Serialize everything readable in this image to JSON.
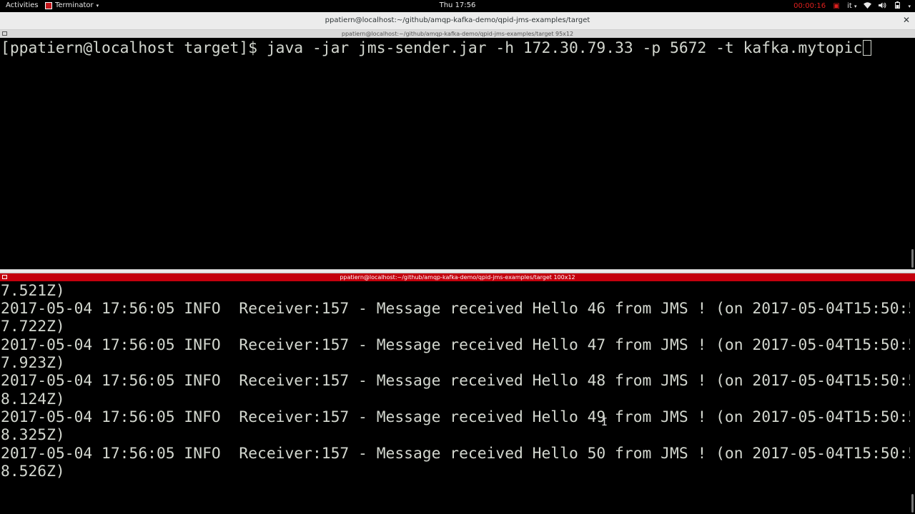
{
  "topbar": {
    "activities_label": "Activities",
    "app_name": "Terminator",
    "clock": "Thu 17:56",
    "recording_time": "00:00:16",
    "language": "it",
    "caret": "▾"
  },
  "window": {
    "title": "ppatiern@localhost:~/github/amqp-kafka-demo/qpid-jms-examples/target",
    "close_glyph": "✕"
  },
  "pane1": {
    "header": "ppatiern@localhost:~/github/amqp-kafka-demo/qpid-jms-examples/target 95x12",
    "prompt": "[ppatiern@localhost target]$ ",
    "command": "java -jar jms-sender.jar -h 172.30.79.33 -p 5672 -t kafka.mytopic"
  },
  "pane2": {
    "header": "ppatiern@localhost:~/github/amqp-kafka-demo/qpid-jms-examples/target 100x12",
    "lines": [
      "7.521Z)",
      "2017-05-04 17:56:05 INFO  Receiver:157 - Message received Hello 46 from JMS ! (on 2017-05-04T15:50:5",
      "7.722Z)",
      "2017-05-04 17:56:05 INFO  Receiver:157 - Message received Hello 47 from JMS ! (on 2017-05-04T15:50:5",
      "7.923Z)",
      "2017-05-04 17:56:05 INFO  Receiver:157 - Message received Hello 48 from JMS ! (on 2017-05-04T15:50:5",
      "8.124Z)",
      "2017-05-04 17:56:05 INFO  Receiver:157 - Message received Hello 49 from JMS ! (on 2017-05-04T15:50:5",
      "8.325Z)",
      "2017-05-04 17:56:05 INFO  Receiver:157 - Message received Hello 50 from JMS ! (on 2017-05-04T15:50:5",
      "8.526Z)"
    ]
  },
  "colors": {
    "active_pane_header": "#c4000d",
    "inactive_pane_header": "#d9d9d9",
    "terminal_bg": "#000000",
    "terminal_fg": "#d3d7cf",
    "recording_red": "#e0201e"
  }
}
